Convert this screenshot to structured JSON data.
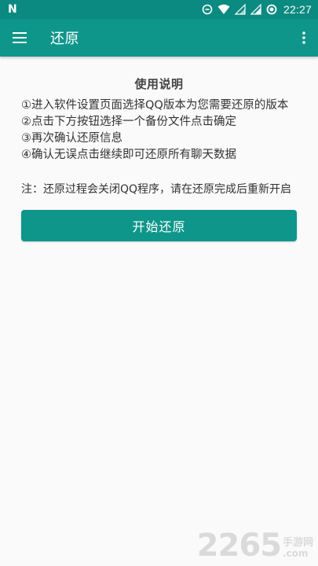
{
  "status_bar": {
    "time": "22:27",
    "icons": [
      "n-logo-icon",
      "data-saver-icon",
      "wifi-icon",
      "signal-icon",
      "battery-icon"
    ],
    "background": "#0a8a80"
  },
  "app_bar": {
    "title": "还原",
    "menu_icon": "hamburger-menu-icon",
    "more_icon": "more-vert-icon",
    "background": "#0e968b"
  },
  "instructions": {
    "title": "使用说明",
    "steps": [
      "①进入软件设置页面选择QQ版本为您需要还原的版本",
      "②点击下方按钮选择一个备份文件点击确定",
      "③再次确认还原信息",
      "④确认无误点击继续即可还原所有聊天数据"
    ],
    "note": "注：还原过程会关闭QQ程序，请在还原完成后重新开启"
  },
  "actions": {
    "start_label": "开始还原"
  },
  "watermark": {
    "number": "2265",
    "cn": "手游网",
    "suffix": ".com"
  },
  "colors": {
    "accent": "#0e968b",
    "text": "#333333",
    "background": "#fafafa"
  }
}
